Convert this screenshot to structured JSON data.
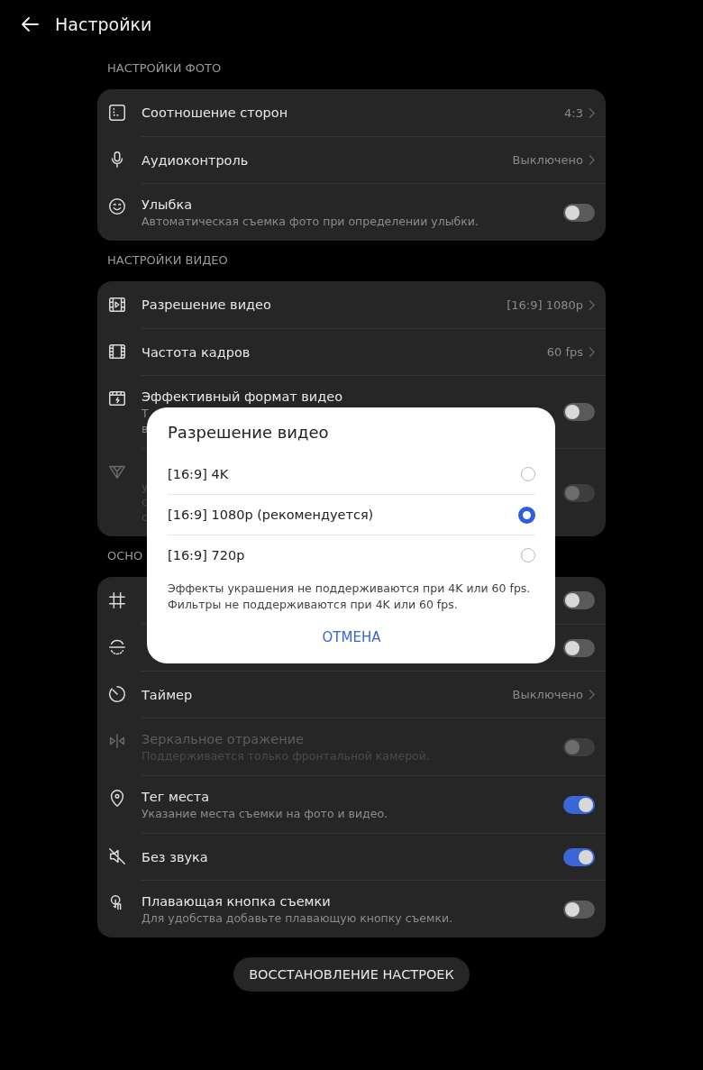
{
  "header": {
    "title": "Настройки"
  },
  "sections": [
    {
      "title": "НАСТРОЙКИ ФОТО",
      "rows": [
        {
          "kind": "value",
          "title": "Соотношение сторон",
          "value": "4:3"
        },
        {
          "kind": "value",
          "title": "Аудиоконтроль",
          "value": "Выключено"
        },
        {
          "kind": "toggle",
          "title": "Улыбка",
          "subtitle_lines": [
            "Автоматическая съемка фото при определении улыбки."
          ],
          "on": false,
          "disabled": false
        }
      ]
    },
    {
      "title": "НАСТРОЙКИ ВИДЕО",
      "rows": [
        {
          "kind": "value",
          "title": "Разрешение видео",
          "value": "[16:9] 1080p"
        },
        {
          "kind": "value",
          "title": "Частота кадров",
          "value": "60 fps"
        },
        {
          "kind": "toggle",
          "title": "Эффективный формат видео",
          "subtitle_lines": [
            "Т",
            "в"
          ],
          "on": false,
          "disabled": false
        },
        {
          "kind": "toggle",
          "subtitle_lines": [
            "у",
            "с",
            "с"
          ],
          "on": false,
          "disabled": true
        }
      ]
    },
    {
      "title": "ОСНО",
      "rows": [
        {
          "kind": "toggle",
          "on": false,
          "disabled": false
        },
        {
          "kind": "toggle",
          "on": false,
          "disabled": false
        },
        {
          "kind": "value",
          "title": "Таймер",
          "value": "Выключено"
        },
        {
          "kind": "toggle",
          "title": "Зеркальное отражение",
          "subtitle_lines": [
            "Поддерживается только фронтальной камерой."
          ],
          "on": false,
          "disabled": true
        },
        {
          "kind": "toggle",
          "title": "Тег места",
          "subtitle_lines": [
            "Указание места съемки на фото и видео."
          ],
          "on": true,
          "disabled": false
        },
        {
          "kind": "toggle",
          "title": "Без звука",
          "on": true,
          "disabled": false
        },
        {
          "kind": "toggle",
          "title": "Плавающая кнопка съемки",
          "subtitle_lines": [
            "Для удобства добавьте плавающую кнопку съемки."
          ],
          "on": false,
          "disabled": false
        }
      ]
    }
  ],
  "reset_button": "ВОССТАНОВЛЕНИЕ НАСТРОЕК",
  "dialog": {
    "title": "Разрешение видео",
    "options": [
      {
        "label": "[16:9] 4K",
        "selected": false
      },
      {
        "label": "[16:9] 1080p (рекомендуется)",
        "selected": true
      },
      {
        "label": "[16:9] 720p",
        "selected": false
      }
    ],
    "note_lines": [
      "Эффекты украшения не поддерживаются при 4K или 60 fps.",
      "Фильтры не поддерживаются при 4K или 60 fps."
    ],
    "cancel": "ОТМЕНА"
  }
}
